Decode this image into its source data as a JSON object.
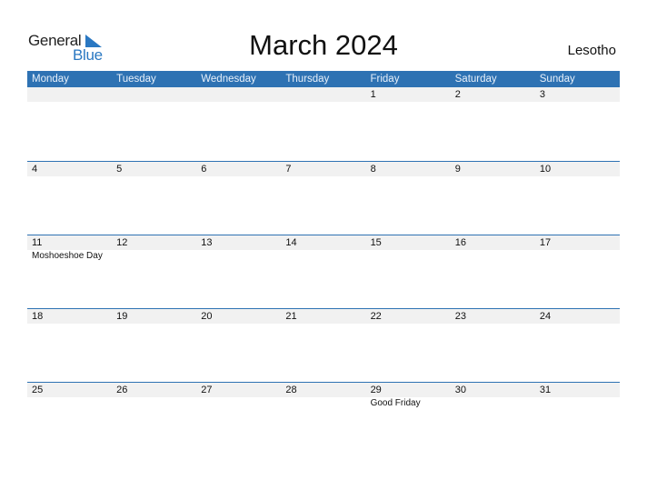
{
  "logo": {
    "general": "General",
    "blue": "Blue"
  },
  "title": "March 2024",
  "country": "Lesotho",
  "colors": {
    "accent": "#2e72b3",
    "strip": "#f1f1f1"
  },
  "weekdays": [
    "Monday",
    "Tuesday",
    "Wednesday",
    "Thursday",
    "Friday",
    "Saturday",
    "Sunday"
  ],
  "weeks": [
    {
      "days": [
        {
          "num": "",
          "event": ""
        },
        {
          "num": "",
          "event": ""
        },
        {
          "num": "",
          "event": ""
        },
        {
          "num": "",
          "event": ""
        },
        {
          "num": "1",
          "event": ""
        },
        {
          "num": "2",
          "event": ""
        },
        {
          "num": "3",
          "event": ""
        }
      ]
    },
    {
      "days": [
        {
          "num": "4",
          "event": ""
        },
        {
          "num": "5",
          "event": ""
        },
        {
          "num": "6",
          "event": ""
        },
        {
          "num": "7",
          "event": ""
        },
        {
          "num": "8",
          "event": ""
        },
        {
          "num": "9",
          "event": ""
        },
        {
          "num": "10",
          "event": ""
        }
      ]
    },
    {
      "days": [
        {
          "num": "11",
          "event": "Moshoeshoe Day"
        },
        {
          "num": "12",
          "event": ""
        },
        {
          "num": "13",
          "event": ""
        },
        {
          "num": "14",
          "event": ""
        },
        {
          "num": "15",
          "event": ""
        },
        {
          "num": "16",
          "event": ""
        },
        {
          "num": "17",
          "event": ""
        }
      ]
    },
    {
      "days": [
        {
          "num": "18",
          "event": ""
        },
        {
          "num": "19",
          "event": ""
        },
        {
          "num": "20",
          "event": ""
        },
        {
          "num": "21",
          "event": ""
        },
        {
          "num": "22",
          "event": ""
        },
        {
          "num": "23",
          "event": ""
        },
        {
          "num": "24",
          "event": ""
        }
      ]
    },
    {
      "days": [
        {
          "num": "25",
          "event": ""
        },
        {
          "num": "26",
          "event": ""
        },
        {
          "num": "27",
          "event": ""
        },
        {
          "num": "28",
          "event": ""
        },
        {
          "num": "29",
          "event": "Good Friday"
        },
        {
          "num": "30",
          "event": ""
        },
        {
          "num": "31",
          "event": ""
        }
      ]
    }
  ]
}
